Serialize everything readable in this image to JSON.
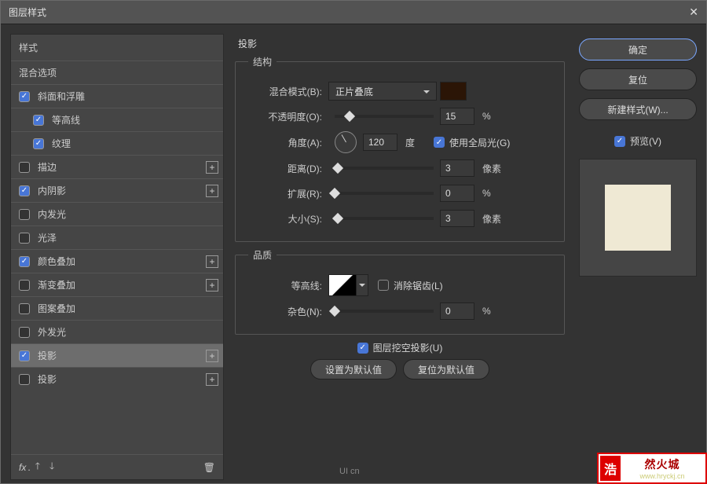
{
  "title": "图层样式",
  "left": {
    "styles_header": "样式",
    "blend_options": "混合选项",
    "items": [
      {
        "label": "斜面和浮雕",
        "checked": true,
        "indent": false,
        "plus": false
      },
      {
        "label": "等高线",
        "checked": true,
        "indent": true,
        "plus": false
      },
      {
        "label": "纹理",
        "checked": true,
        "indent": true,
        "plus": false
      },
      {
        "label": "描边",
        "checked": false,
        "indent": false,
        "plus": true
      },
      {
        "label": "内阴影",
        "checked": true,
        "indent": false,
        "plus": true
      },
      {
        "label": "内发光",
        "checked": false,
        "indent": false,
        "plus": false
      },
      {
        "label": "光泽",
        "checked": false,
        "indent": false,
        "plus": false
      },
      {
        "label": "颜色叠加",
        "checked": true,
        "indent": false,
        "plus": true
      },
      {
        "label": "渐变叠加",
        "checked": false,
        "indent": false,
        "plus": true
      },
      {
        "label": "图案叠加",
        "checked": false,
        "indent": false,
        "plus": false
      },
      {
        "label": "外发光",
        "checked": false,
        "indent": false,
        "plus": false
      },
      {
        "label": "投影",
        "checked": true,
        "indent": false,
        "plus": true,
        "selected": true
      },
      {
        "label": "投影",
        "checked": false,
        "indent": false,
        "plus": true
      }
    ],
    "fx": "fx"
  },
  "main": {
    "title": "投影",
    "structure": {
      "legend": "结构",
      "blend_mode_label": "混合模式(B):",
      "blend_mode_value": "正片叠底",
      "opacity_label": "不透明度(O):",
      "opacity_value": "15",
      "opacity_unit": "%",
      "opacity_pos": "15%",
      "angle_label": "角度(A):",
      "angle_value": "120",
      "angle_unit": "度",
      "global_light": "使用全局光(G)",
      "distance_label": "距离(D):",
      "distance_value": "3",
      "distance_unit": "像素",
      "distance_pos": "3%",
      "spread_label": "扩展(R):",
      "spread_value": "0",
      "spread_unit": "%",
      "spread_pos": "0%",
      "size_label": "大小(S):",
      "size_value": "3",
      "size_unit": "像素",
      "size_pos": "3%"
    },
    "quality": {
      "legend": "品质",
      "contour_label": "等高线:",
      "anti_alias": "消除锯齿(L)",
      "noise_label": "杂色(N):",
      "noise_value": "0",
      "noise_unit": "%",
      "noise_pos": "0%"
    },
    "knockout": "图层挖空投影(U)",
    "make_default": "设置为默认值",
    "reset_default": "复位为默认值"
  },
  "right": {
    "ok": "确定",
    "cancel": "复位",
    "new_style": "新建样式(W)...",
    "preview": "预览(V)"
  },
  "brand": "UI cn",
  "wm": {
    "char": "浩",
    "text": "然火城",
    "url": "www.hryckj.cn"
  }
}
